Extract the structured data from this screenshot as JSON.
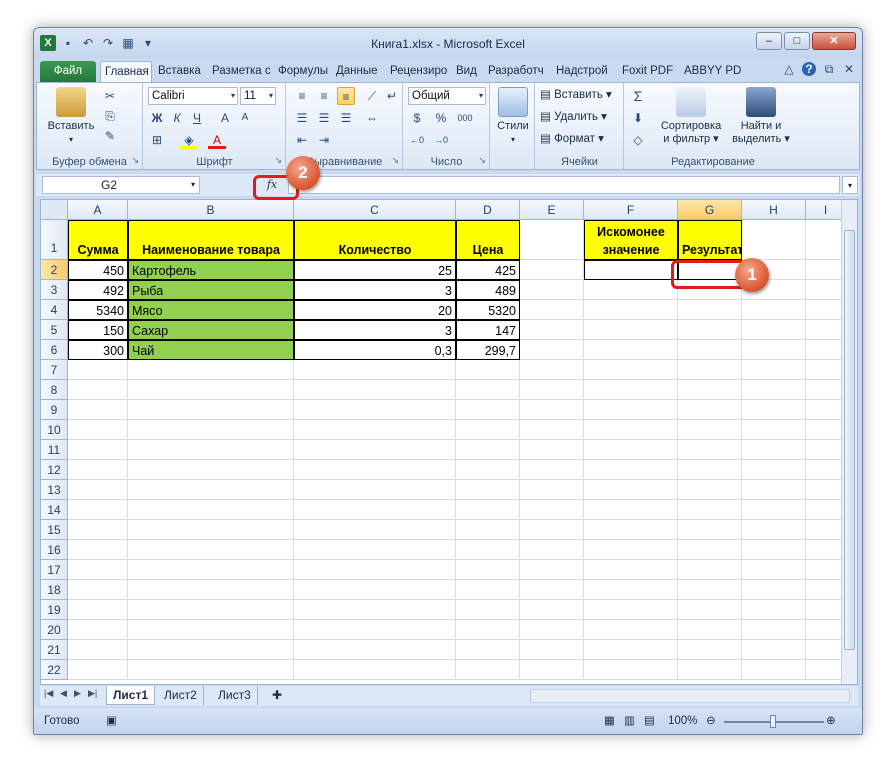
{
  "window": {
    "title": "Книга1.xlsx - Microsoft Excel"
  },
  "tabs": [
    "Файл",
    "Главная",
    "Вставка",
    "Разметка с",
    "Формулы",
    "Данные",
    "Рецензиро",
    "Вид",
    "Разработч",
    "Надстрой",
    "Foxit PDF",
    "ABBYY PDF"
  ],
  "ribbon": {
    "clipboard": {
      "paste": "Вставить",
      "label": "Буфер обмена"
    },
    "font": {
      "name": "Calibri",
      "size": "11",
      "bold": "Ж",
      "italic": "К",
      "underline": "Ч",
      "label": "Шрифт"
    },
    "alignment": {
      "label": "Выравнивание"
    },
    "number": {
      "format": "Общий",
      "currency": "$",
      "percent": "%",
      "thousands": "000",
      "label": "Число"
    },
    "styles": {
      "label": "Стили"
    },
    "cells": {
      "insert": "Вставить",
      "delete": "Удалить",
      "format": "Формат",
      "label": "Ячейки"
    },
    "editing": {
      "sort": "Сортировка",
      "sort2": "и фильтр",
      "find": "Найти и",
      "find2": "выделить",
      "label": "Редактирование"
    }
  },
  "formula_bar": {
    "name_box": "G2",
    "fx": "fx",
    "value": ""
  },
  "columns": [
    "A",
    "B",
    "C",
    "D",
    "E",
    "F",
    "G",
    "H",
    "I"
  ],
  "rows": [
    "1",
    "2",
    "3",
    "4",
    "5",
    "6",
    "7",
    "8",
    "9",
    "10",
    "11",
    "12",
    "13",
    "14",
    "15",
    "16",
    "17",
    "18",
    "19",
    "20",
    "21",
    "22"
  ],
  "table": {
    "headers": {
      "a": "Сумма",
      "b": "Наименование товара",
      "c": "Количество",
      "d": "Цена"
    },
    "rows": [
      {
        "a": "450",
        "b": "Картофель",
        "c": "25",
        "d": "425"
      },
      {
        "a": "492",
        "b": "Рыба",
        "c": "3",
        "d": "489"
      },
      {
        "a": "5340",
        "b": "Мясо",
        "c": "20",
        "d": "5320"
      },
      {
        "a": "150",
        "b": "Сахар",
        "c": "3",
        "d": "147"
      },
      {
        "a": "300",
        "b": "Чай",
        "c": "0,3",
        "d": "299,7"
      }
    ]
  },
  "lookup": {
    "f1_line1": "Искомонее",
    "f1_line2": "значение",
    "g1": "Результат"
  },
  "sheets": [
    "Лист1",
    "Лист2",
    "Лист3"
  ],
  "status": {
    "ready": "Готово",
    "zoom": "100%"
  },
  "callouts": {
    "one": "1",
    "two": "2"
  },
  "colors": {
    "header_yellow": "#ffff00",
    "name_green": "#92d050",
    "callout_red": "#e11a1a"
  }
}
